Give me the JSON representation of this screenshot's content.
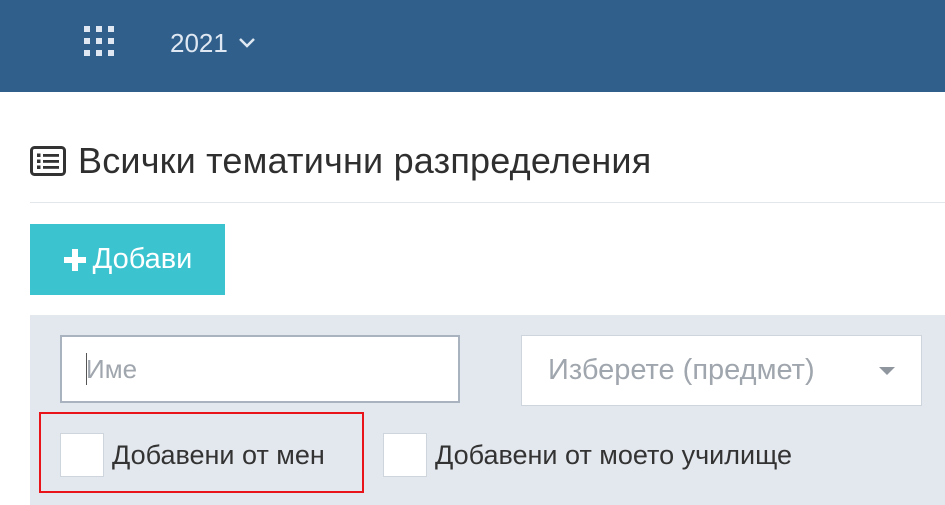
{
  "header": {
    "apps_icon": "grid-icon",
    "year": "2021",
    "year_chevron_icon": "chevron-down-icon",
    "background_color": "#2f5f8a"
  },
  "page": {
    "title": "Всички тематични разпределения",
    "title_icon": "list-icon"
  },
  "toolbar": {
    "add_label": "Добави",
    "add_icon": "plus-icon",
    "add_color": "#3bc4d0"
  },
  "filters": {
    "name_placeholder": "Име",
    "name_value": "",
    "subject_placeholder": "Изберете (предмет)",
    "added_by_me_label": "Добавени от мен",
    "added_by_me_checked": false,
    "added_by_school_label": "Добавени от моето училище",
    "added_by_school_checked": false,
    "highlight_color": "#e8141a"
  }
}
